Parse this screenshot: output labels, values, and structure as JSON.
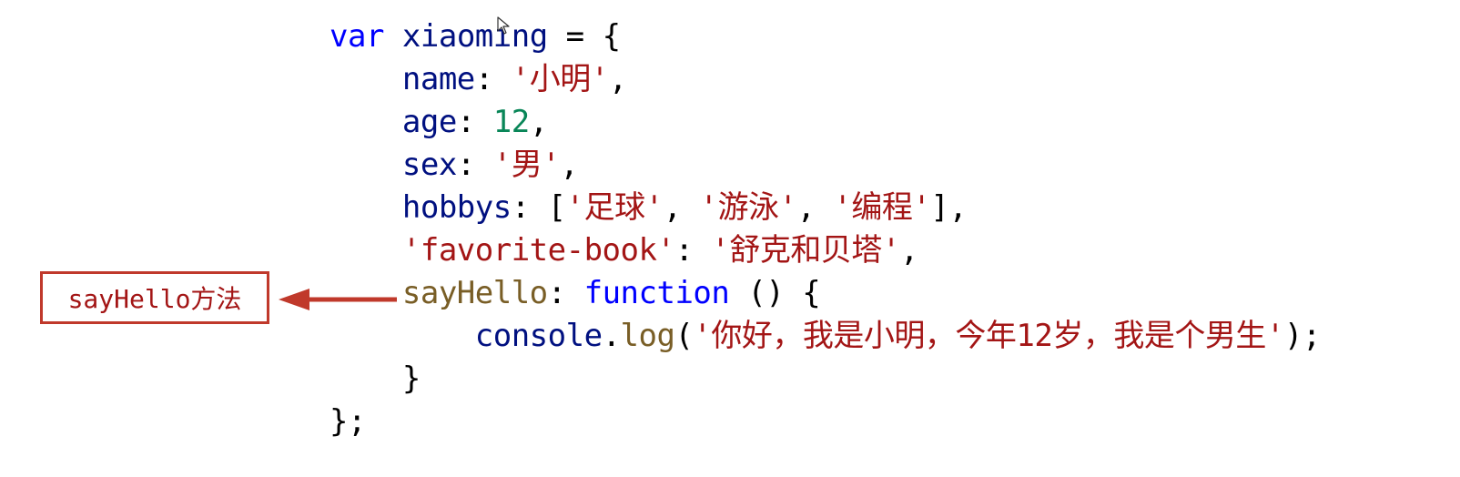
{
  "code": {
    "lines": [
      {
        "indent": "",
        "tokens": [
          [
            "kw",
            "var"
          ],
          [
            "pun",
            " "
          ],
          [
            "id",
            "xiaoming"
          ],
          [
            "pun",
            " = {"
          ]
        ]
      },
      {
        "indent": "    ",
        "tokens": [
          [
            "id",
            "name"
          ],
          [
            "pun",
            ": "
          ],
          [
            "str",
            "'小明'"
          ],
          [
            "pun",
            ","
          ]
        ]
      },
      {
        "indent": "    ",
        "tokens": [
          [
            "id",
            "age"
          ],
          [
            "pun",
            ": "
          ],
          [
            "num",
            "12"
          ],
          [
            "pun",
            ","
          ]
        ]
      },
      {
        "indent": "    ",
        "tokens": [
          [
            "id",
            "sex"
          ],
          [
            "pun",
            ": "
          ],
          [
            "str",
            "'男'"
          ],
          [
            "pun",
            ","
          ]
        ]
      },
      {
        "indent": "    ",
        "tokens": [
          [
            "id",
            "hobbys"
          ],
          [
            "pun",
            ": ["
          ],
          [
            "str",
            "'足球'"
          ],
          [
            "pun",
            ", "
          ],
          [
            "str",
            "'游泳'"
          ],
          [
            "pun",
            ", "
          ],
          [
            "str",
            "'编程'"
          ],
          [
            "pun",
            "],"
          ]
        ]
      },
      {
        "indent": "    ",
        "tokens": [
          [
            "str",
            "'favorite-book'"
          ],
          [
            "pun",
            ": "
          ],
          [
            "str",
            "'舒克和贝塔'"
          ],
          [
            "pun",
            ","
          ]
        ]
      },
      {
        "indent": "    ",
        "tokens": [
          [
            "fn",
            "sayHello"
          ],
          [
            "pun",
            ": "
          ],
          [
            "kw",
            "function"
          ],
          [
            "pun",
            " () {"
          ]
        ]
      },
      {
        "indent": "        ",
        "tokens": [
          [
            "id",
            "console"
          ],
          [
            "pun",
            "."
          ],
          [
            "mth",
            "log"
          ],
          [
            "pun",
            "("
          ],
          [
            "str",
            "'你好，我是小明，今年12岁，我是个男生'"
          ],
          [
            "pun",
            ");"
          ]
        ]
      },
      {
        "indent": "    ",
        "tokens": [
          [
            "pun",
            "}"
          ]
        ]
      },
      {
        "indent": "",
        "tokens": [
          [
            "pun",
            "};"
          ]
        ]
      }
    ]
  },
  "callout": {
    "label": "sayHello方法",
    "color": "#c0392b"
  },
  "colors": {
    "keyword": "#0000ff",
    "identifier": "#001080",
    "string": "#a31515",
    "number": "#098658",
    "function": "#795e26"
  },
  "icons": {
    "cursor": "mouse-pointer-icon",
    "arrow": "left-arrow-icon"
  }
}
